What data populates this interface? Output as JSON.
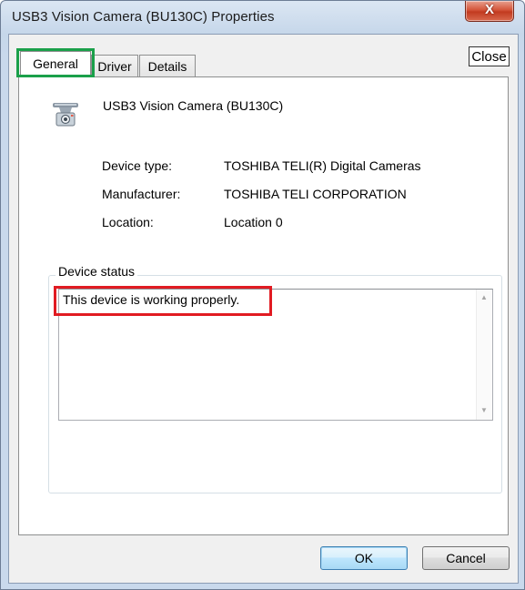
{
  "window": {
    "title": "USB3 Vision Camera (BU130C) Properties",
    "close_glyph": "X"
  },
  "tabs": [
    {
      "label": "General",
      "active": true
    },
    {
      "label": "Driver",
      "active": false
    },
    {
      "label": "Details",
      "active": false
    }
  ],
  "annotation": {
    "close_label": "Close",
    "tab_highlight_color": "#1aa04a",
    "status_highlight_color": "#e11b22"
  },
  "device": {
    "name": "USB3 Vision Camera (BU130C)",
    "icon": "camera-device-icon",
    "properties": [
      {
        "label": "Device type:",
        "value": "TOSHIBA TELI(R) Digital Cameras"
      },
      {
        "label": "Manufacturer:",
        "value": "TOSHIBA TELI CORPORATION"
      },
      {
        "label": "Location:",
        "value": "Location 0"
      }
    ]
  },
  "status": {
    "group_title": "Device status",
    "text": "This device is working properly."
  },
  "buttons": {
    "ok": "OK",
    "cancel": "Cancel"
  }
}
